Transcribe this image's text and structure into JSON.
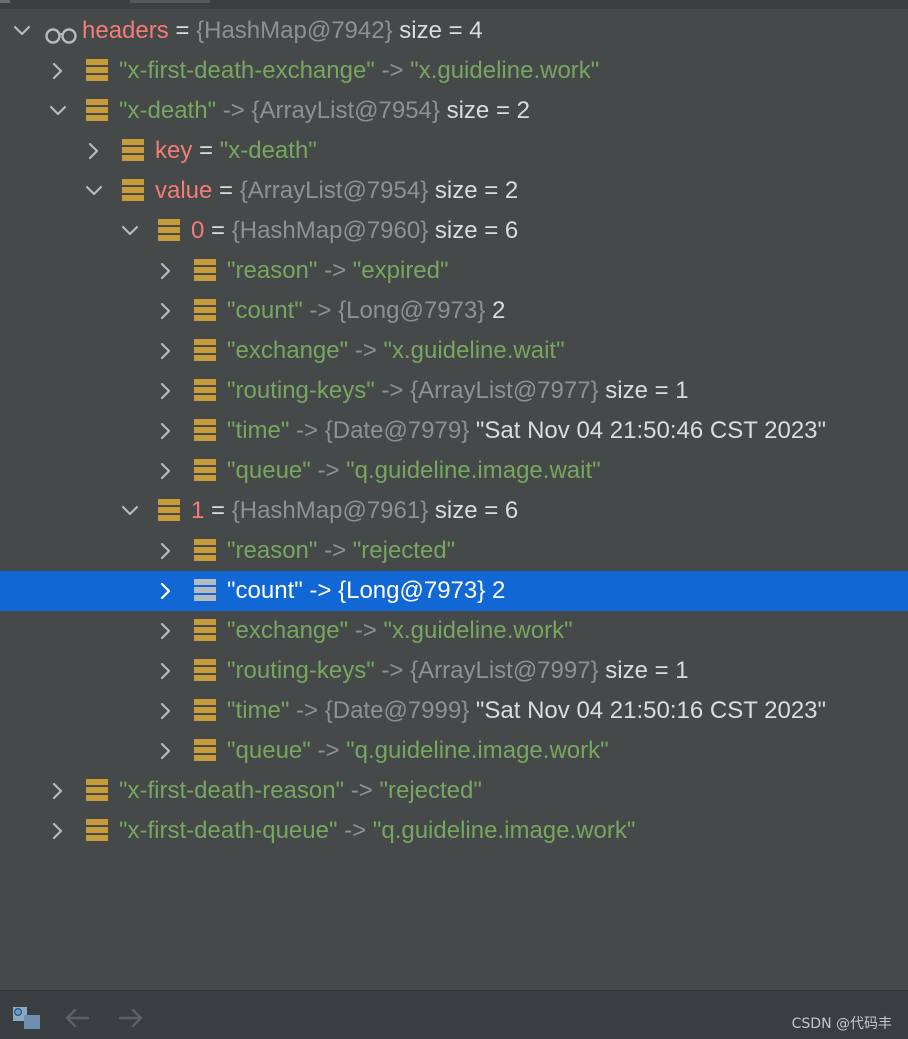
{
  "tree": [
    {
      "depth": 0,
      "expanded": true,
      "icon": "watch-glasses-icon",
      "selected": false,
      "parts": [
        {
          "t": "headers",
          "c": "red"
        },
        {
          "t": " = ",
          "c": "wht"
        },
        {
          "t": "{HashMap@7942}",
          "c": "gry"
        },
        {
          "t": "  size = 4",
          "c": "wht"
        }
      ]
    },
    {
      "depth": 1,
      "expanded": false,
      "icon": "field-icon",
      "selected": false,
      "parts": [
        {
          "t": "\"x-first-death-exchange\"",
          "c": "grn"
        },
        {
          "t": " -> ",
          "c": "gry"
        },
        {
          "t": "\"x.guideline.work\"",
          "c": "grn"
        }
      ]
    },
    {
      "depth": 1,
      "expanded": true,
      "icon": "field-icon",
      "selected": false,
      "parts": [
        {
          "t": "\"x-death\"",
          "c": "grn"
        },
        {
          "t": " -> ",
          "c": "gry"
        },
        {
          "t": "{ArrayList@7954}",
          "c": "gry"
        },
        {
          "t": "  size = 2",
          "c": "wht"
        }
      ]
    },
    {
      "depth": 2,
      "expanded": false,
      "icon": "field-icon",
      "selected": false,
      "parts": [
        {
          "t": "key",
          "c": "red"
        },
        {
          "t": " = ",
          "c": "wht"
        },
        {
          "t": "\"x-death\"",
          "c": "grn"
        }
      ]
    },
    {
      "depth": 2,
      "expanded": true,
      "icon": "field-icon",
      "selected": false,
      "parts": [
        {
          "t": "value",
          "c": "red"
        },
        {
          "t": " = ",
          "c": "wht"
        },
        {
          "t": "{ArrayList@7954}",
          "c": "gry"
        },
        {
          "t": "  size = 2",
          "c": "wht"
        }
      ]
    },
    {
      "depth": 3,
      "expanded": true,
      "icon": "field-icon",
      "selected": false,
      "parts": [
        {
          "t": "0",
          "c": "red"
        },
        {
          "t": " = ",
          "c": "wht"
        },
        {
          "t": "{HashMap@7960}",
          "c": "gry"
        },
        {
          "t": "  size = 6",
          "c": "wht"
        }
      ]
    },
    {
      "depth": 4,
      "expanded": false,
      "icon": "field-icon",
      "selected": false,
      "parts": [
        {
          "t": "\"reason\"",
          "c": "grn"
        },
        {
          "t": " -> ",
          "c": "gry"
        },
        {
          "t": "\"expired\"",
          "c": "grn"
        }
      ]
    },
    {
      "depth": 4,
      "expanded": false,
      "icon": "field-icon",
      "selected": false,
      "parts": [
        {
          "t": "\"count\"",
          "c": "grn"
        },
        {
          "t": " -> ",
          "c": "gry"
        },
        {
          "t": "{Long@7973}",
          "c": "gry"
        },
        {
          "t": " 2",
          "c": "wht"
        }
      ]
    },
    {
      "depth": 4,
      "expanded": false,
      "icon": "field-icon",
      "selected": false,
      "parts": [
        {
          "t": "\"exchange\"",
          "c": "grn"
        },
        {
          "t": " -> ",
          "c": "gry"
        },
        {
          "t": "\"x.guideline.wait\"",
          "c": "grn"
        }
      ]
    },
    {
      "depth": 4,
      "expanded": false,
      "icon": "field-icon",
      "selected": false,
      "parts": [
        {
          "t": "\"routing-keys\"",
          "c": "grn"
        },
        {
          "t": " -> ",
          "c": "gry"
        },
        {
          "t": "{ArrayList@7977}",
          "c": "gry"
        },
        {
          "t": "  size = 1",
          "c": "wht"
        }
      ]
    },
    {
      "depth": 4,
      "expanded": false,
      "icon": "field-icon",
      "selected": false,
      "parts": [
        {
          "t": "\"time\"",
          "c": "grn"
        },
        {
          "t": " -> ",
          "c": "gry"
        },
        {
          "t": "{Date@7979}",
          "c": "gry"
        },
        {
          "t": " \"Sat Nov 04 21:50:46 CST 2023\"",
          "c": "wht"
        }
      ]
    },
    {
      "depth": 4,
      "expanded": false,
      "icon": "field-icon",
      "selected": false,
      "parts": [
        {
          "t": "\"queue\"",
          "c": "grn"
        },
        {
          "t": " -> ",
          "c": "gry"
        },
        {
          "t": "\"q.guideline.image.wait\"",
          "c": "grn"
        }
      ]
    },
    {
      "depth": 3,
      "expanded": true,
      "icon": "field-icon",
      "selected": false,
      "parts": [
        {
          "t": "1",
          "c": "red"
        },
        {
          "t": " = ",
          "c": "wht"
        },
        {
          "t": "{HashMap@7961}",
          "c": "gry"
        },
        {
          "t": "  size = 6",
          "c": "wht"
        }
      ]
    },
    {
      "depth": 4,
      "expanded": false,
      "icon": "field-icon",
      "selected": false,
      "parts": [
        {
          "t": "\"reason\"",
          "c": "grn"
        },
        {
          "t": " -> ",
          "c": "gry"
        },
        {
          "t": "\"rejected\"",
          "c": "grn"
        }
      ]
    },
    {
      "depth": 4,
      "expanded": false,
      "icon": "field-icon",
      "selected": true,
      "parts": [
        {
          "t": "\"count\"",
          "c": "grn"
        },
        {
          "t": " -> ",
          "c": "gry"
        },
        {
          "t": "{Long@7973}",
          "c": "gry"
        },
        {
          "t": " 2",
          "c": "wht"
        }
      ]
    },
    {
      "depth": 4,
      "expanded": false,
      "icon": "field-icon",
      "selected": false,
      "parts": [
        {
          "t": "\"exchange\"",
          "c": "grn"
        },
        {
          "t": " -> ",
          "c": "gry"
        },
        {
          "t": "\"x.guideline.work\"",
          "c": "grn"
        }
      ]
    },
    {
      "depth": 4,
      "expanded": false,
      "icon": "field-icon",
      "selected": false,
      "parts": [
        {
          "t": "\"routing-keys\"",
          "c": "grn"
        },
        {
          "t": " -> ",
          "c": "gry"
        },
        {
          "t": "{ArrayList@7997}",
          "c": "gry"
        },
        {
          "t": "  size = 1",
          "c": "wht"
        }
      ]
    },
    {
      "depth": 4,
      "expanded": false,
      "icon": "field-icon",
      "selected": false,
      "parts": [
        {
          "t": "\"time\"",
          "c": "grn"
        },
        {
          "t": " -> ",
          "c": "gry"
        },
        {
          "t": "{Date@7999}",
          "c": "gry"
        },
        {
          "t": " \"Sat Nov 04 21:50:16 CST 2023\"",
          "c": "wht"
        }
      ]
    },
    {
      "depth": 4,
      "expanded": false,
      "icon": "field-icon",
      "selected": false,
      "parts": [
        {
          "t": "\"queue\"",
          "c": "grn"
        },
        {
          "t": " -> ",
          "c": "gry"
        },
        {
          "t": "\"q.guideline.image.work\"",
          "c": "grn"
        }
      ]
    },
    {
      "depth": 1,
      "expanded": false,
      "icon": "field-icon",
      "selected": false,
      "parts": [
        {
          "t": "\"x-first-death-reason\"",
          "c": "grn"
        },
        {
          "t": " -> ",
          "c": "gry"
        },
        {
          "t": "\"rejected\"",
          "c": "grn"
        }
      ]
    },
    {
      "depth": 1,
      "expanded": false,
      "icon": "field-icon",
      "selected": false,
      "parts": [
        {
          "t": "\"x-first-death-queue\"",
          "c": "grn"
        },
        {
          "t": " -> ",
          "c": "gry"
        },
        {
          "t": "\"q.guideline.image.work\"",
          "c": "grn"
        }
      ]
    }
  ],
  "toolbar": {
    "items": [
      {
        "name": "frames-view-icon",
        "enabled": true
      },
      {
        "name": "back-arrow-icon",
        "enabled": false
      },
      {
        "name": "forward-arrow-icon",
        "enabled": false
      }
    ]
  },
  "watermark": "CSDN @代码丰",
  "colors": {
    "background": "#45494a",
    "selection": "#1168d4",
    "name_red": "#f27c78",
    "string_green": "#78a65f",
    "type_gray": "#8e9193",
    "field_icon": "#c79a3a"
  }
}
